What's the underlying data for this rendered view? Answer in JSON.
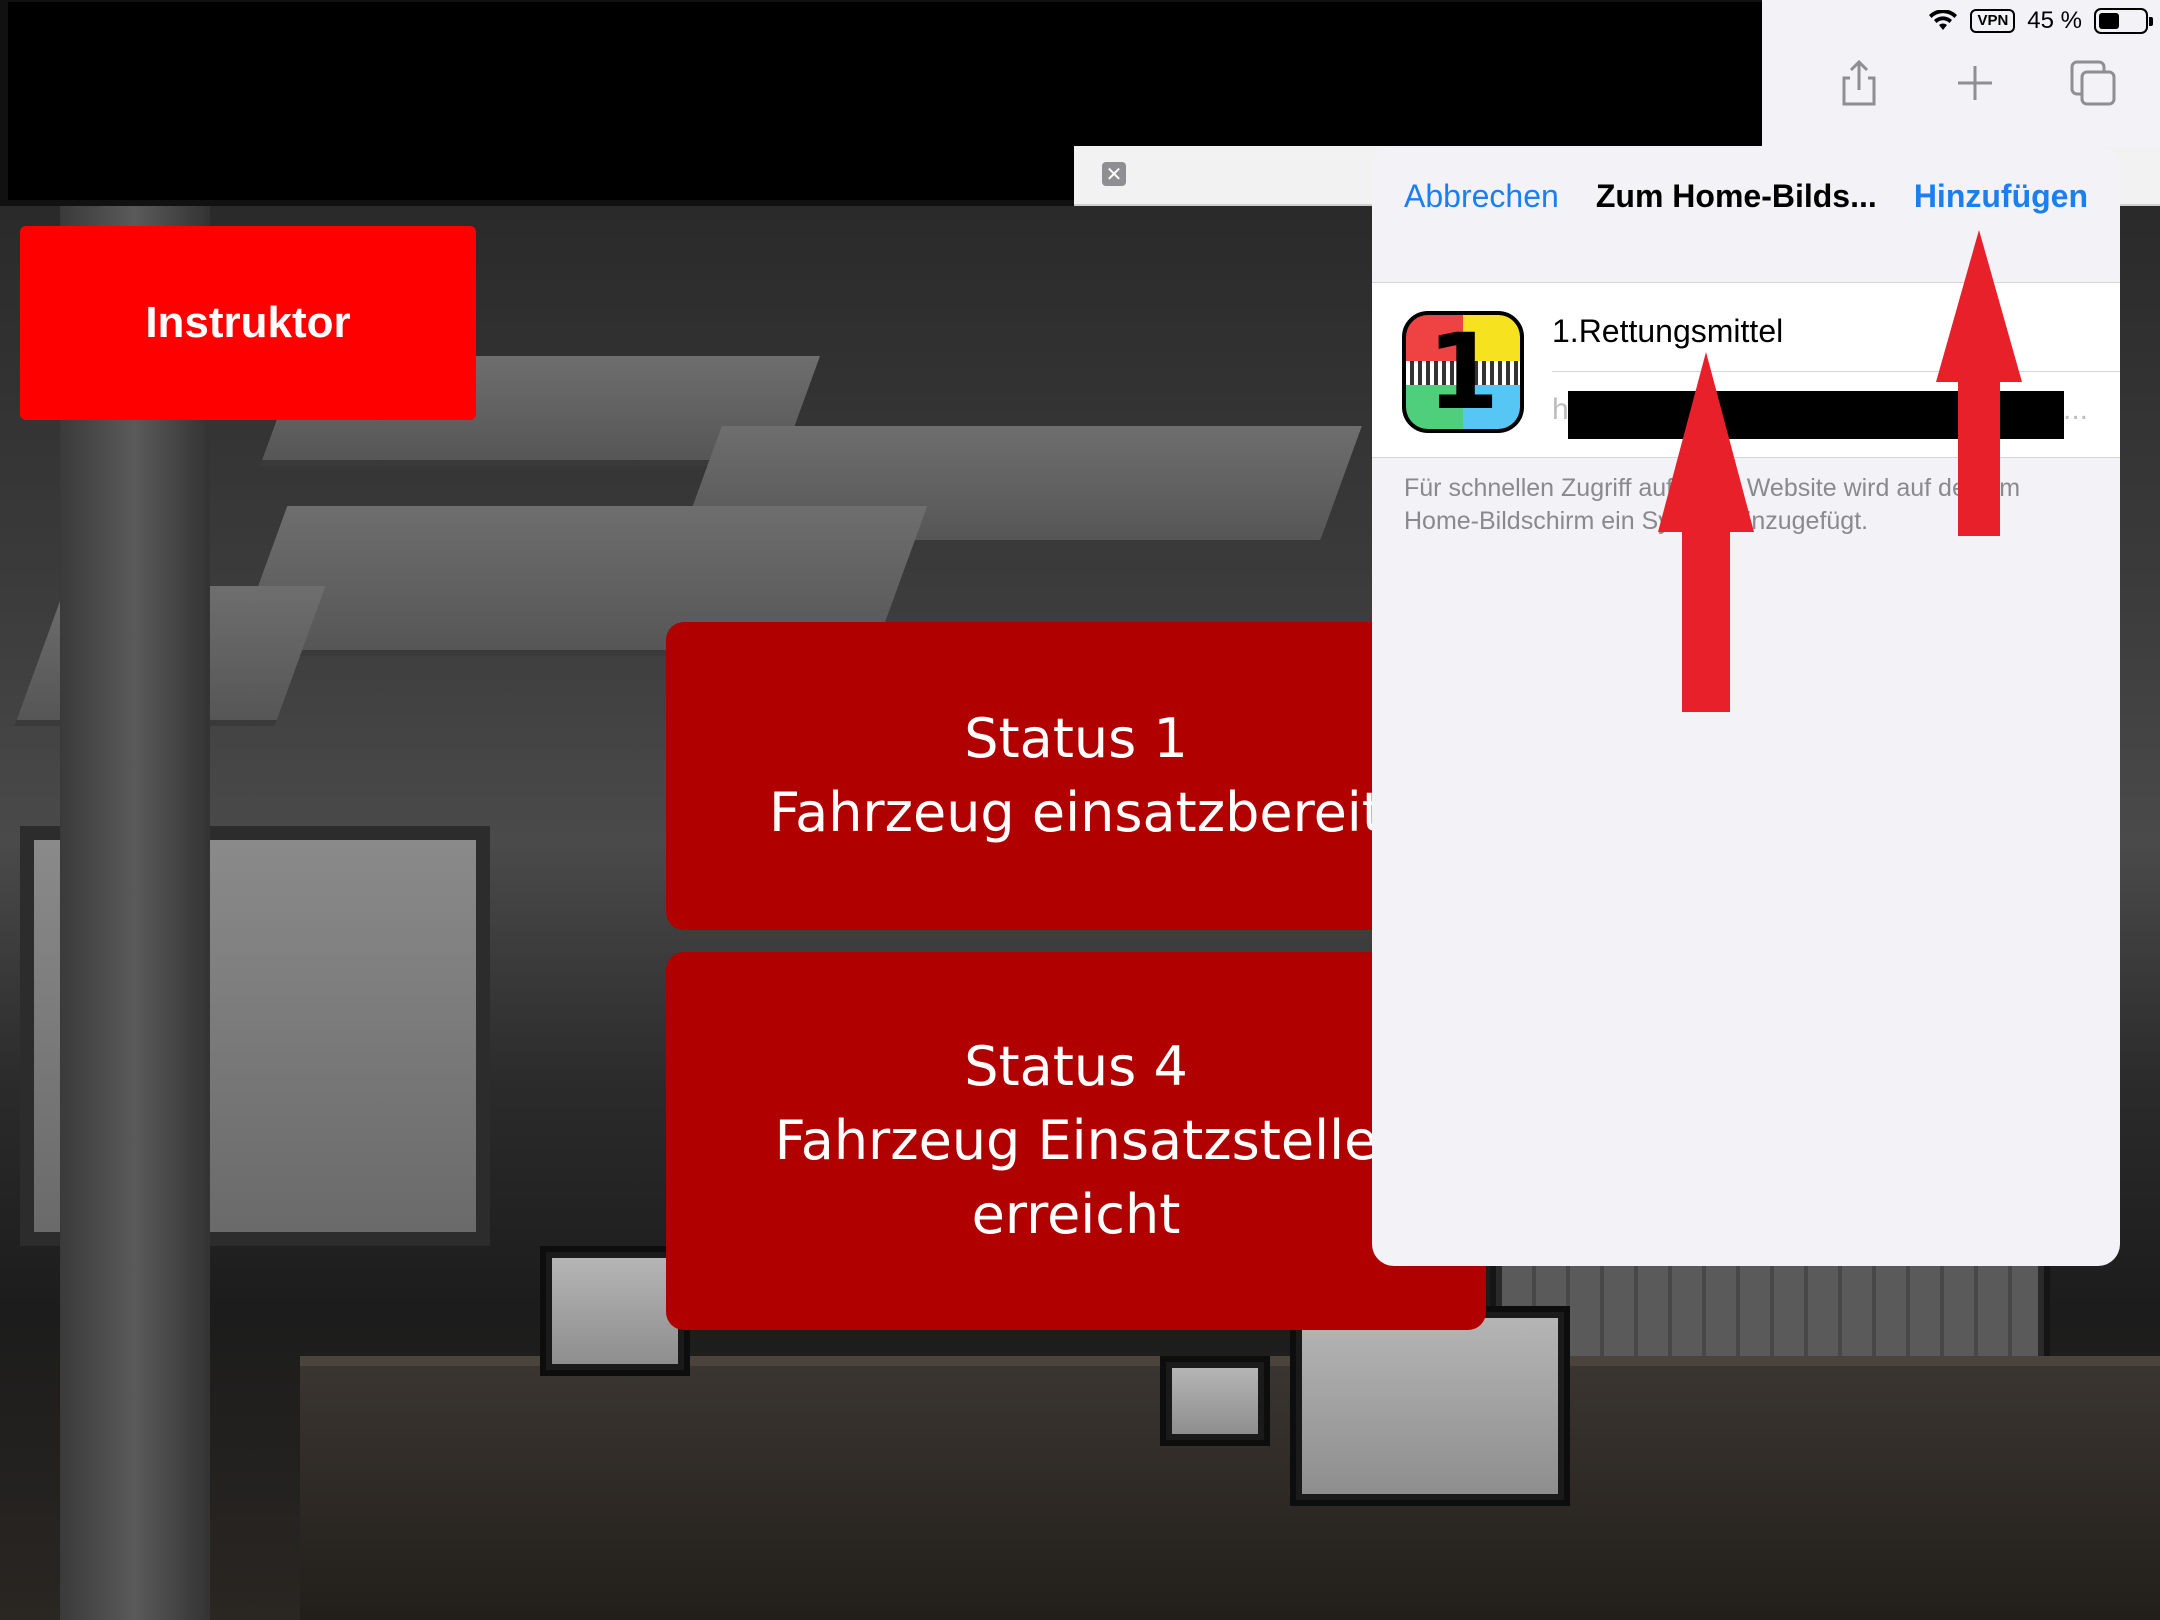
{
  "statusbar": {
    "vpn": "VPN",
    "battery": "45 %",
    "battery_level": 0.45
  },
  "toolbar": {
    "share_icon": "share-icon",
    "add_tab_icon": "plus-icon",
    "tabs_icon": "tabs-overview-icon"
  },
  "tab": {
    "close_glyph": "✕"
  },
  "page": {
    "instruktor_label": "Instruktor",
    "status1_line1": "Status 1",
    "status1_line2": "Fahrzeug einsatzbereit",
    "status4_line1": "Status 4",
    "status4_line2": "Fahrzeug Einsatzstelle",
    "status4_line3": "erreicht"
  },
  "popover": {
    "cancel_label": "Abbrechen",
    "title": "Zum Home-Bilds...",
    "add_label": "Hinzufügen",
    "app_name": "1.Rettungsmittel",
    "url_prefix": "h",
    "url_ellipsis": "...",
    "hint": "Für schnellen Zugriff auf diese Website wird auf deinem Home-Bildschirm ein Symbol hinzugefügt.",
    "app_icon_number": "1"
  },
  "colors": {
    "ios_blue": "#1c7ff0",
    "instruktor_red": "#ff0000",
    "status_red": "#b00000",
    "annotation_red": "#e8202a"
  }
}
